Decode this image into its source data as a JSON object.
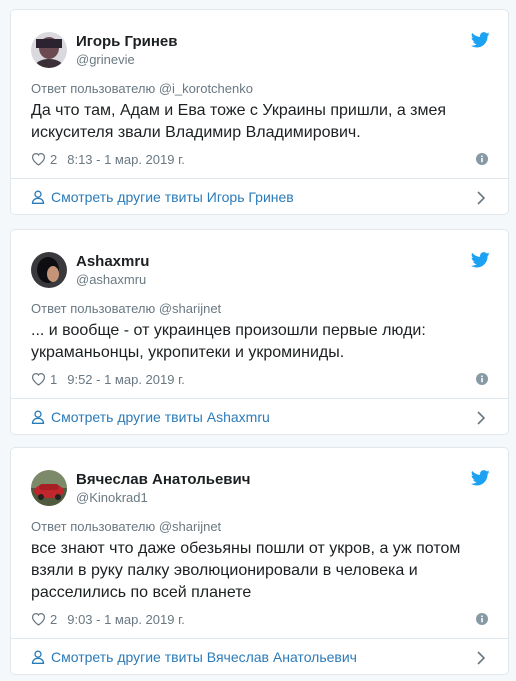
{
  "colors": {
    "accent": "#2b7bb9",
    "twitter_blue": "#1da1f2",
    "muted": "#697882"
  },
  "icons": {
    "logo": "twitter-bird-icon",
    "like": "heart-icon",
    "info": "info-icon",
    "profile": "person-icon",
    "more": "chevron-right-icon"
  },
  "tweets": [
    {
      "name": "Игорь Гринев",
      "handle": "@grinevie",
      "reply_to": "Ответ пользователю @i_korotchenko",
      "text": "Да что там, Адам и Ева тоже с Украины пришли, а змея искусителя звали Владимир Владимирович.",
      "likes": "2",
      "timestamp": "8:13 - 1 мар. 2019 г.",
      "more_link": "Смотреть другие твиты Игорь Гринев"
    },
    {
      "name": "Ashaxmru",
      "handle": "@ashaxmru",
      "reply_to": "Ответ пользователю @sharijnet",
      "text": "... и вообще - от украинцев произошли первые люди: украманьонцы, укропитеки и укроминиды.",
      "likes": "1",
      "timestamp": "9:52 - 1 мар. 2019 г.",
      "more_link": "Смотреть другие твиты Ashaxmru"
    },
    {
      "name": "Вячеслав Анатольевич",
      "handle": "@Kinokrad1",
      "reply_to": "Ответ пользователю @sharijnet",
      "text": "все знают что даже обезьяны пошли от укров, а уж потом взяли в руку палку эволюционировали в человека и расселились по всей планете",
      "likes": "2",
      "timestamp": "9:03 - 1 мар. 2019 г.",
      "more_link": "Смотреть другие твиты Вячеслав Анатольевич"
    }
  ]
}
